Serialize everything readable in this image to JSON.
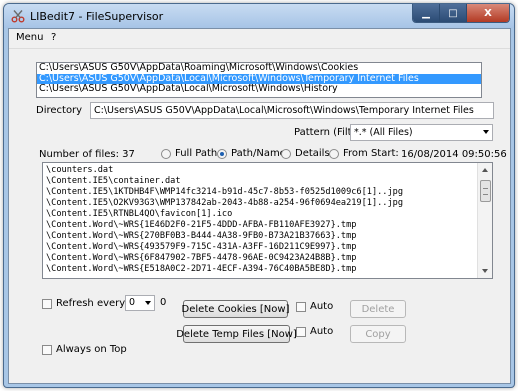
{
  "window": {
    "title": "LIBedit7 - FileSupervisor",
    "minimize_symbol": "▁",
    "maximize_symbol": "□",
    "close_symbol": "X",
    "app_icon": "scissors-icon"
  },
  "menubar": {
    "items": [
      {
        "label": "Menu"
      },
      {
        "label": "?"
      }
    ]
  },
  "paths": {
    "items": [
      {
        "label": "C:\\Users\\ASUS G50V\\AppData\\Roaming\\Microsoft\\Windows\\Cookies",
        "selected": false
      },
      {
        "label": "C:\\Users\\ASUS G50V\\AppData\\Local\\Microsoft\\Windows\\Temporary Internet Files",
        "selected": true
      },
      {
        "label": "C:\\Users\\ASUS G50V\\AppData\\Local\\Microsoft\\Windows\\History",
        "selected": false
      }
    ]
  },
  "directory": {
    "label": "Directory",
    "value": "C:\\Users\\ASUS G50V\\AppData\\Local\\Microsoft\\Windows\\Temporary Internet Files"
  },
  "filter": {
    "label": "Pattern (Filter)",
    "value": "*.* (All Files)"
  },
  "file_count": {
    "label": "Number of files: 37"
  },
  "view_options": {
    "full_path": "Full Path",
    "path_name": "Path/Name",
    "details": "Details",
    "from_start": "From Start:",
    "selected": "Path/Name",
    "start_time": "16/08/2014 09:50:56"
  },
  "files": [
    "\\counters.dat",
    "\\Content.IE5\\container.dat",
    "\\Content.IE5\\1KTDHB4F\\WMP14fc3214-b91d-45c7-8b53-f0525d1009c6[1]..jpg",
    "\\Content.IE5\\O2KV93G3\\WMP137842ab-2043-4b88-a254-96f0694ea219[1]..jpg",
    "\\Content.IE5\\RTNBL4QO\\favicon[1].ico",
    "\\Content.Word\\~WRS{1E46D2F0-21F5-4DDD-AFBA-FB110AFE3927}.tmp",
    "\\Content.Word\\~WRS{270BF0B3-B444-4A38-9FB0-B73A21B37663}.tmp",
    "\\Content.Word\\~WRS{493579F9-715C-431A-A3FF-16D211C9E997}.tmp",
    "\\Content.Word\\~WRS{6F847902-7BF5-4478-96AE-0C9423A24B8B}.tmp",
    "\\Content.Word\\~WRS{E518A0C2-2D71-4ECF-A394-76C40BA5BE8D}.tmp"
  ],
  "controls": {
    "refresh_label": "Refresh every",
    "refresh_interval": "0",
    "refresh_suffix": "0",
    "delete_cookies": "Delete Cookies [Now]",
    "delete_temp": "Delete Temp Files [Now]",
    "auto_label_1": "Auto",
    "auto_label_2": "Auto",
    "delete_button": "Delete",
    "copy_button": "Copy",
    "always_on_top": "Always on Top"
  }
}
